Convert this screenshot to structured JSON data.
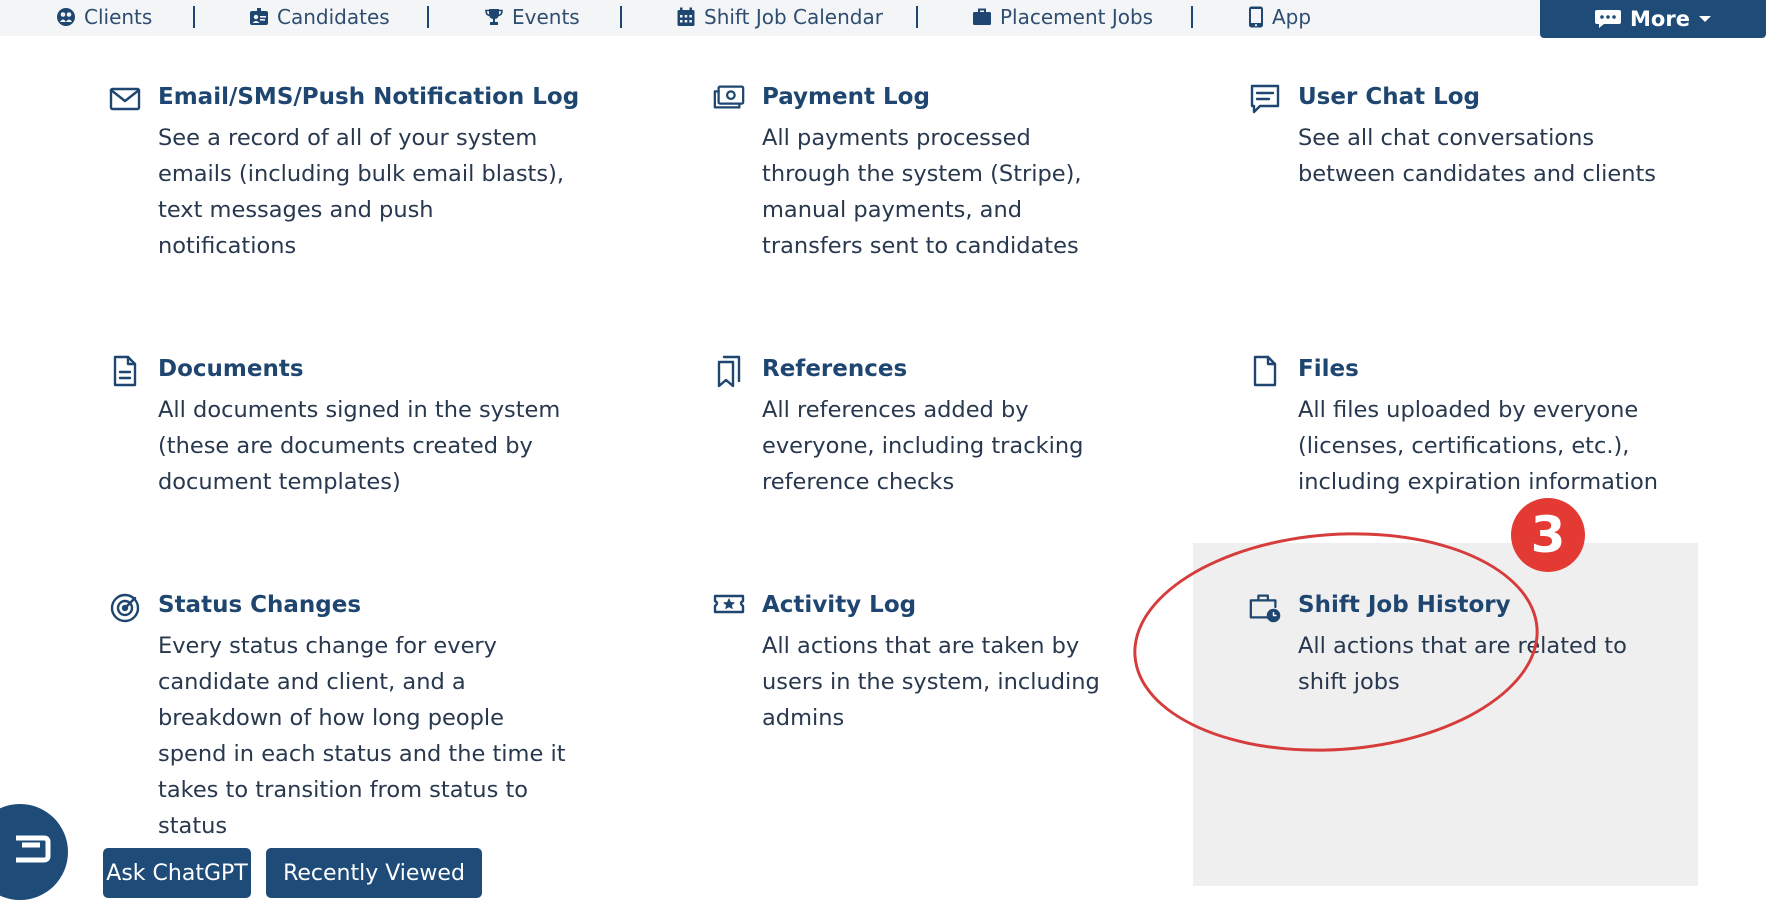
{
  "nav": {
    "items": [
      {
        "label": "Clients",
        "icon": "clients-icon"
      },
      {
        "label": "Candidates",
        "icon": "candidates-icon"
      },
      {
        "label": "Events",
        "icon": "trophy-icon"
      },
      {
        "label": "Shift Job Calendar",
        "icon": "calendar-icon"
      },
      {
        "label": "Placement Jobs",
        "icon": "briefcase-icon"
      },
      {
        "label": "App",
        "icon": "phone-icon"
      }
    ],
    "more_label": "More"
  },
  "cards": [
    {
      "title": "Email/SMS/Push Notification Log",
      "icon": "envelope-icon",
      "lines": [
        "See a record of all of your system",
        "emails (including bulk email blasts),",
        "text messages and push",
        "notifications"
      ]
    },
    {
      "title": "Payment Log",
      "icon": "payment-icon",
      "lines": [
        "All payments processed",
        "through the system (Stripe),",
        "manual payments, and",
        "transfers sent to candidates"
      ]
    },
    {
      "title": "User Chat Log",
      "icon": "chat-log-icon",
      "lines": [
        "See all chat conversations",
        "between candidates and clients"
      ]
    },
    {
      "title": "Documents",
      "icon": "document-icon",
      "lines": [
        "All documents signed in the system",
        "(these are documents created by",
        "document templates)"
      ]
    },
    {
      "title": "References",
      "icon": "bookmarks-icon",
      "lines": [
        "All references added by",
        "everyone, including tracking",
        "reference checks"
      ]
    },
    {
      "title": "Files",
      "icon": "file-icon",
      "lines": [
        "All files uploaded by everyone",
        "(licenses, certifications, etc.),",
        "including expiration information"
      ]
    },
    {
      "title": "Status Changes",
      "icon": "status-radar-icon",
      "lines": [
        "Every status change for every",
        "candidate and client, and a",
        "breakdown of how long people",
        "spend in each status and the time it",
        "takes to transition from status to",
        "status"
      ]
    },
    {
      "title": "Activity Log",
      "icon": "activity-ticket-icon",
      "lines": [
        "All actions that are taken by",
        "users in the system, including",
        "admins"
      ]
    },
    {
      "title": "Shift Job History",
      "icon": "briefcase-clock-icon",
      "lines": [
        "All actions that are related to",
        "shift jobs"
      ]
    }
  ],
  "annotation": {
    "step_number": "3",
    "color": "#e33b34"
  },
  "bottom": {
    "ask_chatgpt": "Ask ChatGPT",
    "recently_viewed": "Recently Viewed"
  },
  "colors": {
    "brand": "#1e4b78",
    "text": "#28384e",
    "highlight": "#efefef"
  }
}
